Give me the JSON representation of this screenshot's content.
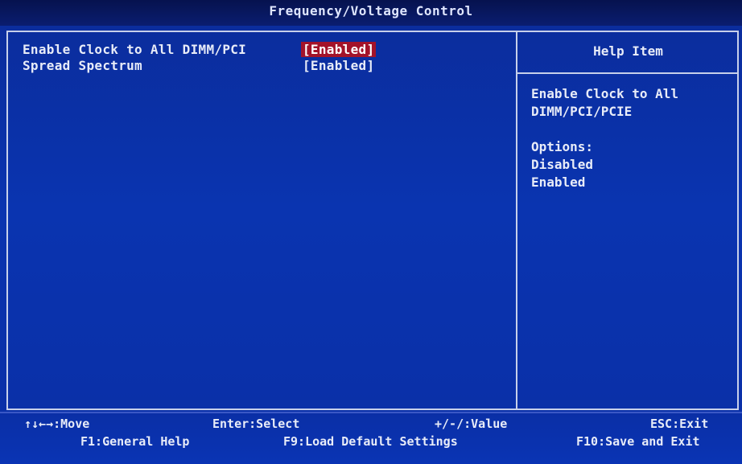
{
  "title": "Frequency/Voltage Control",
  "options": [
    {
      "label": "Enable Clock to All DIMM/PCI",
      "value": "[Enabled]",
      "selected": true
    },
    {
      "label": "Spread Spectrum",
      "value": "[Enabled]",
      "selected": false
    }
  ],
  "help": {
    "title": "Help Item",
    "lines": [
      "Enable Clock to All",
      "DIMM/PCI/PCIE",
      "",
      "Options:",
      "Disabled",
      "Enabled"
    ]
  },
  "footer": {
    "move": "↑↓←→:Move",
    "select": "Enter:Select",
    "value": "+/-/:Value",
    "exit": "ESC:Exit",
    "general_help": "F1:General Help",
    "load_defaults": "F9:Load Default Settings",
    "save_exit": "F10:Save and Exit"
  },
  "colors": {
    "background": "#0a34b0",
    "highlight": "#a3132a",
    "text": "#e8ecf8"
  }
}
